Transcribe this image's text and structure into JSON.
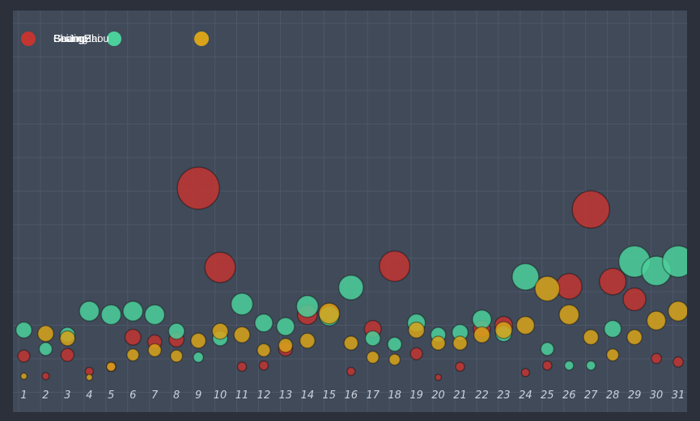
{
  "chart_data": {
    "type": "scatter",
    "title": "",
    "xlabel": "",
    "ylabel": "",
    "categories": [
      "1",
      "2",
      "3",
      "4",
      "5",
      "6",
      "7",
      "8",
      "9",
      "10",
      "11",
      "12",
      "13",
      "14",
      "15",
      "16",
      "17",
      "18",
      "19",
      "20",
      "21",
      "22",
      "23",
      "24",
      "25",
      "26",
      "27",
      "28",
      "29",
      "30",
      "31"
    ],
    "ylim": [
      0,
      300
    ],
    "legend_position": "top-left",
    "grid": true,
    "bubble_size_encodes": "value",
    "series": [
      {
        "name": "BeiJing",
        "color": "#c23531",
        "points": [
          [
            1,
            18,
            9
          ],
          [
            2,
            1,
            4
          ],
          [
            3,
            19,
            10
          ],
          [
            4,
            5,
            5
          ],
          [
            5,
            9,
            6
          ],
          [
            6,
            34,
            13
          ],
          [
            7,
            30,
            11
          ],
          [
            8,
            32,
            12
          ],
          [
            9,
            160,
            40
          ],
          [
            10,
            93,
            28
          ],
          [
            11,
            9,
            6
          ],
          [
            12,
            10,
            6
          ],
          [
            13,
            24,
            11
          ],
          [
            14,
            53,
            17
          ],
          [
            15,
            54,
            17
          ],
          [
            16,
            5,
            5
          ],
          [
            17,
            41,
            14
          ],
          [
            18,
            94,
            28
          ],
          [
            19,
            20,
            9
          ],
          [
            20,
            0,
            3
          ],
          [
            21,
            9,
            6
          ],
          [
            22,
            41,
            14
          ],
          [
            23,
            44,
            15
          ],
          [
            24,
            4,
            5
          ],
          [
            25,
            10,
            6
          ],
          [
            26,
            77,
            23
          ],
          [
            27,
            142,
            35
          ],
          [
            28,
            81,
            24
          ],
          [
            29,
            66,
            20
          ],
          [
            30,
            16,
            7
          ],
          [
            31,
            13,
            7
          ]
        ]
      },
      {
        "name": "ShangHai",
        "color": "#4cd09b",
        "points": [
          [
            1,
            40,
            13
          ],
          [
            2,
            24,
            10
          ],
          [
            3,
            36,
            12
          ],
          [
            4,
            56,
            17
          ],
          [
            5,
            53,
            17
          ],
          [
            6,
            56,
            17
          ],
          [
            7,
            53,
            17
          ],
          [
            8,
            39,
            13
          ],
          [
            9,
            17,
            7
          ],
          [
            10,
            33,
            12
          ],
          [
            11,
            62,
            19
          ],
          [
            12,
            46,
            15
          ],
          [
            13,
            43,
            15
          ],
          [
            14,
            60,
            19
          ],
          [
            15,
            52,
            17
          ],
          [
            16,
            76,
            22
          ],
          [
            17,
            33,
            12
          ],
          [
            18,
            28,
            11
          ],
          [
            19,
            46,
            15
          ],
          [
            20,
            36,
            12
          ],
          [
            21,
            38,
            13
          ],
          [
            22,
            49,
            16
          ],
          [
            23,
            37,
            13
          ],
          [
            24,
            85,
            24
          ],
          [
            25,
            24,
            10
          ],
          [
            26,
            10,
            6
          ],
          [
            27,
            10,
            6
          ],
          [
            28,
            41,
            14
          ],
          [
            29,
            98,
            29
          ],
          [
            30,
            90,
            27
          ],
          [
            31,
            98,
            29
          ]
        ]
      },
      {
        "name": "GuangZhou",
        "color": "#d8a31a",
        "points": [
          [
            1,
            1,
            3
          ],
          [
            2,
            37,
            13
          ],
          [
            3,
            33,
            12
          ],
          [
            4,
            0,
            3
          ],
          [
            5,
            9,
            6
          ],
          [
            6,
            19,
            9
          ],
          [
            7,
            23,
            10
          ],
          [
            8,
            18,
            9
          ],
          [
            9,
            31,
            12
          ],
          [
            10,
            39,
            13
          ],
          [
            11,
            36,
            13
          ],
          [
            12,
            23,
            10
          ],
          [
            13,
            27,
            11
          ],
          [
            14,
            31,
            12
          ],
          [
            15,
            54,
            18
          ],
          [
            16,
            29,
            11
          ],
          [
            17,
            17,
            9
          ],
          [
            18,
            15,
            8
          ],
          [
            19,
            40,
            13
          ],
          [
            20,
            29,
            11
          ],
          [
            21,
            29,
            11
          ],
          [
            22,
            36,
            13
          ],
          [
            23,
            40,
            14
          ],
          [
            24,
            44,
            15
          ],
          [
            25,
            75,
            22
          ],
          [
            26,
            53,
            17
          ],
          [
            27,
            34,
            12
          ],
          [
            28,
            19,
            9
          ],
          [
            29,
            34,
            12
          ],
          [
            30,
            48,
            16
          ],
          [
            31,
            56,
            17
          ]
        ]
      }
    ]
  }
}
